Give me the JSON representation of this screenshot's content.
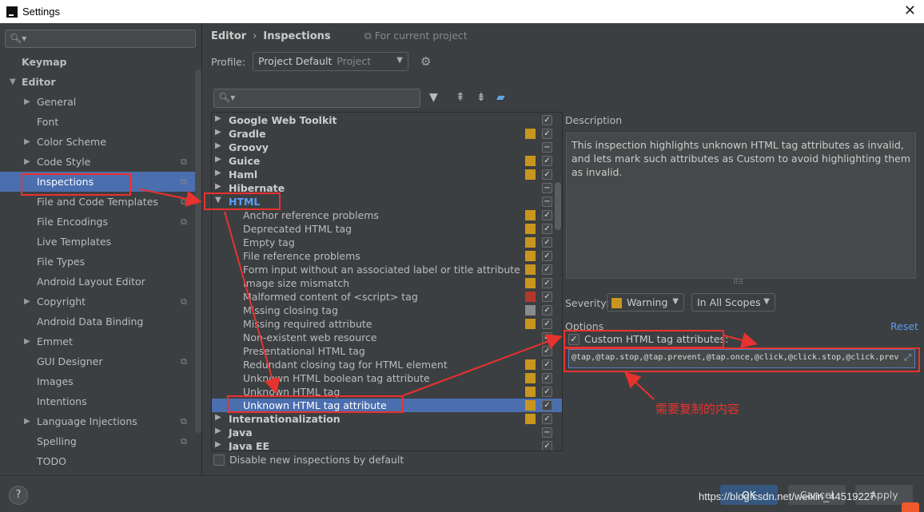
{
  "window": {
    "title": "Settings"
  },
  "sidebar": {
    "items": [
      {
        "label": "Keymap",
        "bold": true,
        "arrow": ""
      },
      {
        "label": "Editor",
        "bold": true,
        "arrow": "▼"
      },
      {
        "label": "General",
        "arrow": "▶"
      },
      {
        "label": "Font",
        "arrow": ""
      },
      {
        "label": "Color Scheme",
        "arrow": "▶"
      },
      {
        "label": "Code Style",
        "arrow": "▶",
        "copy": true
      },
      {
        "label": "Inspections",
        "arrow": "",
        "copy": true,
        "selected": true
      },
      {
        "label": "File and Code Templates",
        "arrow": "",
        "copy": true
      },
      {
        "label": "File Encodings",
        "arrow": "",
        "copy": true
      },
      {
        "label": "Live Templates",
        "arrow": ""
      },
      {
        "label": "File Types",
        "arrow": ""
      },
      {
        "label": "Android Layout Editor",
        "arrow": ""
      },
      {
        "label": "Copyright",
        "arrow": "▶",
        "copy": true
      },
      {
        "label": "Android Data Binding",
        "arrow": ""
      },
      {
        "label": "Emmet",
        "arrow": "▶"
      },
      {
        "label": "GUI Designer",
        "arrow": "",
        "copy": true
      },
      {
        "label": "Images",
        "arrow": ""
      },
      {
        "label": "Intentions",
        "arrow": ""
      },
      {
        "label": "Language Injections",
        "arrow": "▶",
        "copy": true
      },
      {
        "label": "Spelling",
        "arrow": "",
        "copy": true
      },
      {
        "label": "TODO",
        "arrow": ""
      }
    ]
  },
  "breadcrumb": {
    "parent": "Editor",
    "sep": "›",
    "current": "Inspections",
    "scope": "For current project"
  },
  "profile": {
    "label": "Profile:",
    "value": "Project Default",
    "sub": "Project"
  },
  "inspections": [
    {
      "label": "Google Web Toolkit",
      "type": "cat",
      "arrow": "▶",
      "sev": "",
      "check": "✓"
    },
    {
      "label": "Gradle",
      "type": "cat",
      "arrow": "▶",
      "sev": "#c8951e",
      "check": "✓"
    },
    {
      "label": "Groovy",
      "type": "cat",
      "arrow": "▶",
      "sev": "",
      "check": "−"
    },
    {
      "label": "Guice",
      "type": "cat",
      "arrow": "▶",
      "sev": "#c8951e",
      "check": "✓"
    },
    {
      "label": "Haml",
      "type": "cat",
      "arrow": "▶",
      "sev": "#c8951e",
      "check": "✓"
    },
    {
      "label": "Hibernate",
      "type": "cat",
      "arrow": "▶",
      "sev": "",
      "check": "−"
    },
    {
      "label": "HTML",
      "type": "cat",
      "arrow": "▼",
      "sev": "",
      "check": "−",
      "blue": true
    },
    {
      "label": "Anchor reference problems",
      "type": "child",
      "sev": "#c8951e",
      "check": "✓"
    },
    {
      "label": "Deprecated HTML tag",
      "type": "child",
      "sev": "#c8951e",
      "check": "✓"
    },
    {
      "label": "Empty tag",
      "type": "child",
      "sev": "#c8951e",
      "check": "✓"
    },
    {
      "label": "File reference problems",
      "type": "child",
      "sev": "#c8951e",
      "check": "✓"
    },
    {
      "label": "Form input without an associated label or title attribute",
      "type": "child",
      "sev": "#c8951e",
      "check": "✓"
    },
    {
      "label": "Image size mismatch",
      "type": "child",
      "sev": "#c8951e",
      "check": "✓"
    },
    {
      "label": "Malformed content of <script> tag",
      "type": "child",
      "sev": "#b2382b",
      "check": "✓"
    },
    {
      "label": "Missing closing tag",
      "type": "child",
      "sev": "#8a8a8a",
      "check": "✓"
    },
    {
      "label": "Missing required attribute",
      "type": "child",
      "sev": "#c8951e",
      "check": "✓"
    },
    {
      "label": "Non-existent web resource",
      "type": "child",
      "sev": "",
      "check": "✓"
    },
    {
      "label": "Presentational HTML tag",
      "type": "child",
      "sev": "",
      "check": "✓"
    },
    {
      "label": "Redundant closing tag for HTML element",
      "type": "child",
      "sev": "#c8951e",
      "check": "✓"
    },
    {
      "label": "Unknown HTML boolean tag attribute",
      "type": "child",
      "sev": "#c8951e",
      "check": "✓"
    },
    {
      "label": "Unknown HTML tag",
      "type": "child",
      "sev": "#c8951e",
      "check": "✓"
    },
    {
      "label": "Unknown HTML tag attribute",
      "type": "child",
      "sev": "#c8951e",
      "check": "✓",
      "selected": true
    },
    {
      "label": "Internationalization",
      "type": "cat",
      "arrow": "▶",
      "sev": "#c8951e",
      "check": "✓"
    },
    {
      "label": "Java",
      "type": "cat",
      "arrow": "▶",
      "sev": "",
      "check": "−"
    },
    {
      "label": "Java EE",
      "type": "cat",
      "arrow": "▶",
      "sev": "",
      "check": "✓"
    }
  ],
  "disable_new": "Disable new inspections by default",
  "description": {
    "title": "Description",
    "text": "This inspection highlights unknown HTML tag attributes as invalid, and lets mark such attributes as Custom to avoid highlighting them as invalid."
  },
  "severity": {
    "label": "Severity:",
    "value": "Warning",
    "scope": "In All Scopes"
  },
  "options": {
    "label": "Options",
    "reset": "Reset",
    "custom_label": "Custom HTML tag attributes:",
    "custom_value": "@tap,@tap.stop,@tap.prevent,@tap.once,@click,@click.stop,@click.prev"
  },
  "annotation": "需要复制的内容",
  "footer": {
    "help": "?",
    "ok": "OK",
    "cancel": "Cancel",
    "apply": "Apply",
    "watermark": "https://blog.csdn.net/weixin_44519227"
  },
  "colors": {
    "accent": "#4b6eaf",
    "annotation": "#e8322e",
    "warning": "#c8951e"
  }
}
